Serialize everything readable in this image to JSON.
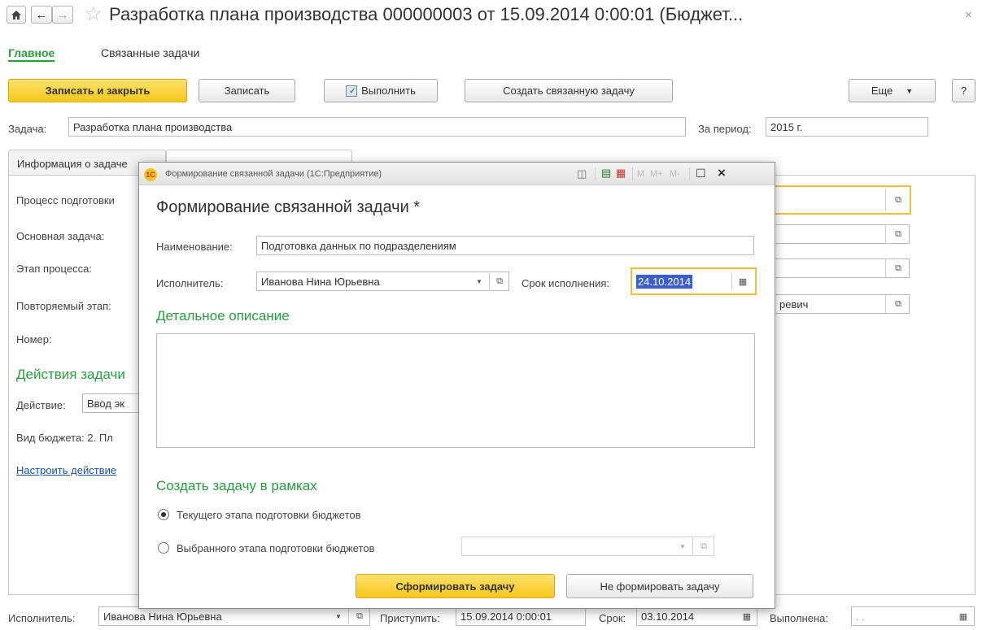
{
  "window": {
    "title": "Разработка плана производства 000000003 от 15.09.2014 0:00:01 (Бюджет...",
    "close_icon": "close-icon"
  },
  "nav": {
    "tabs": [
      "Главное",
      "Связанные задачи"
    ]
  },
  "toolbar": {
    "save_close": "Записать и закрыть",
    "save": "Записать",
    "execute": "Выполнить",
    "create_related": "Создать связанную задачу",
    "more": "Еще",
    "help": "?"
  },
  "task": {
    "label": "Задача:",
    "value": "Разработка плана производства",
    "period_label": "За период:",
    "period_value": "2015 г."
  },
  "tabs": {
    "info": "Информация о задаче"
  },
  "bg_form": {
    "process_label": "Процесс подготовки",
    "main_task_label": "Основная задача:",
    "stage_label": "Этап процесса:",
    "repeat_stage_label": "Повторяемый этап:",
    "repeat_stage_value_tail": "ревич",
    "number_label": "Номер:",
    "actions_heading": "Действия задачи",
    "action_label": "Действие:",
    "action_value": "Ввод эк",
    "budget_kind": "Вид бюджета: 2. Пл",
    "configure_link": "Настроить действие"
  },
  "footer": {
    "executor_label": "Исполнитель:",
    "executor_value": "Иванова Нина Юрьевна",
    "start_label": "Приступить:",
    "start_value": "15.09.2014  0:00:01",
    "due_label": "Срок:",
    "due_value": "03.10.2014",
    "done_label": "Выполнена:",
    "done_value": ". ."
  },
  "modal": {
    "window_title": "Формирование связанной задачи  (1С:Предприятие)",
    "calc_buttons": [
      "M",
      "M+",
      "M-"
    ],
    "heading": "Формирование связанной задачи *",
    "name_label": "Наименование:",
    "name_value": "Подготовка данных по подразделениям",
    "executor_label": "Исполнитель:",
    "executor_value": "Иванова Нина Юрьевна",
    "deadline_label": "Срок исполнения:",
    "deadline_value": "24.10.2014",
    "description_heading": "Детальное описание",
    "description_value": "",
    "create_heading": "Создать задачу в рамках",
    "radio_current": "Текущего этапа подготовки бюджетов",
    "radio_selected": "Выбранного этапа подготовки бюджетов",
    "selected_stage_value": "",
    "form_button": "Сформировать задачу",
    "cancel_button": "Не формировать задачу"
  },
  "colors": {
    "accent_green": "#2a9d3f",
    "button_yellow": "#f5c71d",
    "focus_border": "#f0c040",
    "selection": "#3a5fcd"
  }
}
